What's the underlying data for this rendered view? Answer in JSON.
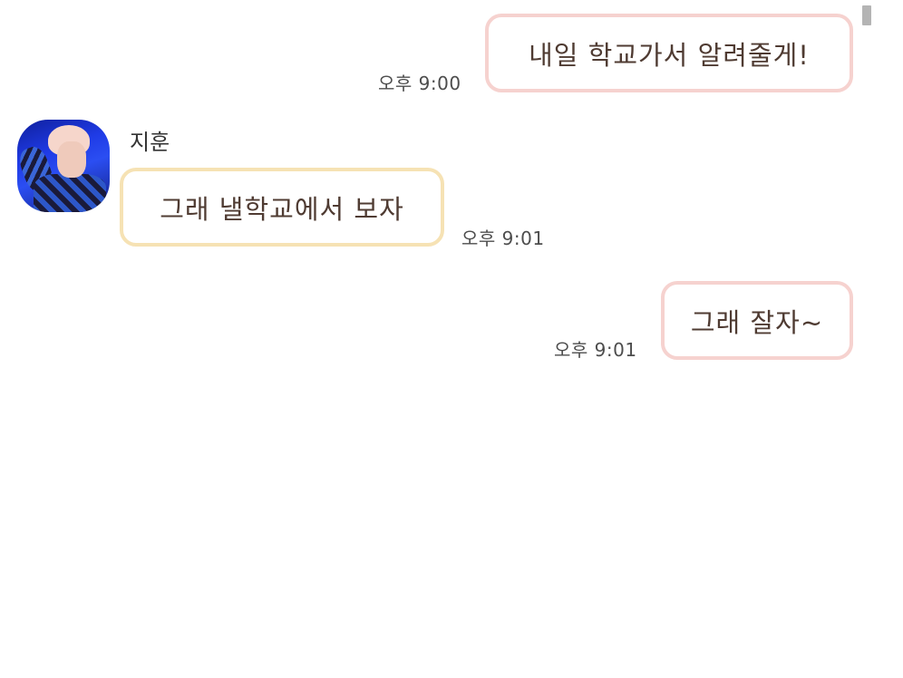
{
  "messages": [
    {
      "sender": "me",
      "text": "내일 학교가서 알려줄게!",
      "time": "오후 9:00"
    },
    {
      "sender": "them",
      "name": "지훈",
      "text": "그래 낼학교에서 보자",
      "time": "오후 9:01"
    },
    {
      "sender": "me",
      "text": "그래 잘자~",
      "time": "오후 9:01"
    }
  ],
  "colors": {
    "my_bubble_border": "#f6d2cf",
    "their_bubble_border": "#f6e2b4"
  }
}
